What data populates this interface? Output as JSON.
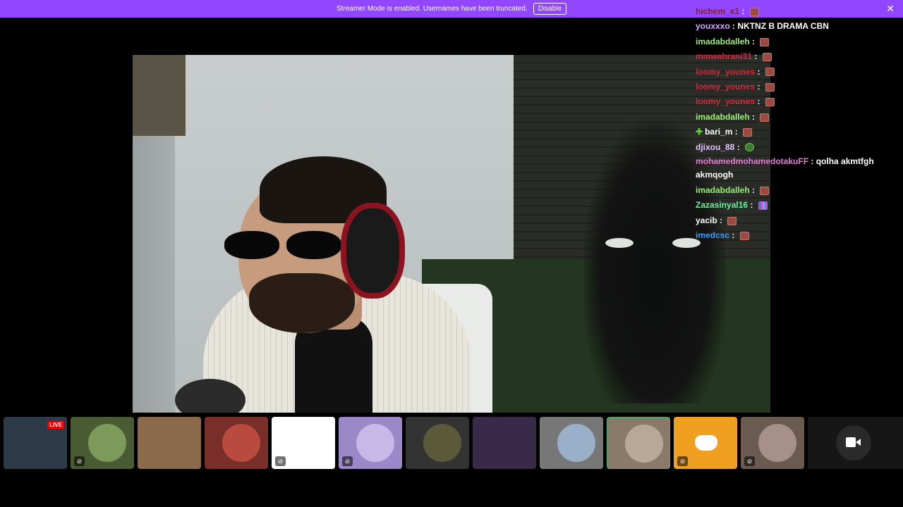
{
  "banner": {
    "message": "Streamer Mode is enabled. Usernames have been truncated.",
    "disable_label": "Disable",
    "close_icon": "close-icon",
    "color": "#9146ff"
  },
  "chat": {
    "messages": [
      {
        "user": "hichem_x1",
        "text": "",
        "emote": true,
        "color": "#8b1e2d"
      },
      {
        "user": "youxxxo",
        "text": "NKTNZ B DRAMA CBN",
        "emote": false,
        "color": "#d6a8ff"
      },
      {
        "user": "imadabdalleh",
        "text": "",
        "emote": true,
        "color": "#9cf078"
      },
      {
        "user": "mmwahrani31",
        "text": "",
        "emote": true,
        "color": "#d6283e"
      },
      {
        "user": "loomy_younes",
        "text": "",
        "emote": true,
        "color": "#d6283e"
      },
      {
        "user": "loomy_younes",
        "text": "",
        "emote": true,
        "color": "#d6283e"
      },
      {
        "user": "loomy_younes",
        "text": "",
        "emote": true,
        "color": "#d6283e"
      },
      {
        "user": "imadabdalleh",
        "text": "",
        "emote": true,
        "color": "#9cf078"
      },
      {
        "user": "bari_m",
        "text": "",
        "emote": true,
        "color": "#ffffff",
        "badge": "plus"
      },
      {
        "user": "djixou_88",
        "text": "",
        "emote": true,
        "emote_style": "green",
        "color": "#e6c7ff"
      },
      {
        "user": "mohamedmohamedotakuFF",
        "text": "qolha akmtfgh akmqogh",
        "emote": false,
        "color": "#e87ad8"
      },
      {
        "user": "imadabdalleh",
        "text": "",
        "emote": true,
        "color": "#9cf078"
      },
      {
        "user": "Zazasinyal16",
        "text": "",
        "emote": true,
        "emote_style": "bars",
        "color": "#6ef5a0"
      },
      {
        "user": "yacib",
        "text": "",
        "emote": true,
        "color": "#ffffff"
      },
      {
        "user": "imedcsc",
        "text": "",
        "emote": true,
        "color": "#3f9bf5"
      }
    ]
  },
  "participants": {
    "live_badge": "LIVE",
    "tiles": [
      {
        "name": "tile-streamer-live",
        "bg": "#2c3a4a",
        "live": true,
        "muted": false
      },
      {
        "name": "tile-participant-2",
        "bg": "#4a5a32",
        "avatar": "#7c9a5a",
        "muted": true
      },
      {
        "name": "tile-participant-3",
        "bg": "#8a6a4a",
        "muted": false
      },
      {
        "name": "tile-participant-4",
        "bg": "#7a2e2a",
        "avatar": "#b84a3e",
        "muted": false
      },
      {
        "name": "tile-participant-5",
        "bg": "#ffffff",
        "muted": true
      },
      {
        "name": "tile-participant-6",
        "bg": "#9a88c8",
        "avatar": "#c8b8e8",
        "muted": true
      },
      {
        "name": "tile-participant-7",
        "bg": "#333333",
        "avatar": "#5a5a3a",
        "muted": false
      },
      {
        "name": "tile-participant-8",
        "bg": "#3a2a4a",
        "muted": false
      },
      {
        "name": "tile-participant-9",
        "bg": "#777777",
        "avatar": "#9ab0c8",
        "muted": false
      },
      {
        "name": "tile-participant-10",
        "bg": "#8a7a6a",
        "avatar": "#b8a898",
        "muted": false,
        "selected": true
      },
      {
        "name": "tile-participant-discord",
        "bg": "#f0a020",
        "muted": true,
        "discord": true
      },
      {
        "name": "tile-participant-12",
        "bg": "#6a5a50",
        "avatar": "#a8908a",
        "muted": true
      }
    ],
    "camera_button": "camera-icon"
  }
}
